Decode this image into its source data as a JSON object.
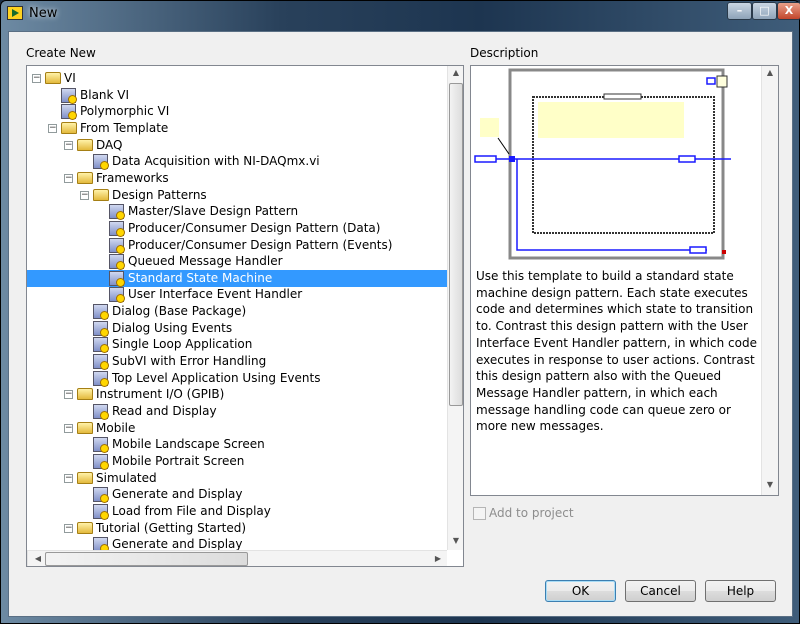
{
  "window": {
    "title": "New",
    "minimize": "–",
    "maximize": "□",
    "close": "X"
  },
  "create_new_label": "Create New",
  "description_label": "Description",
  "tree": [
    {
      "label": "VI",
      "level": 0,
      "type": "folder"
    },
    {
      "label": "Blank VI",
      "level": 1,
      "type": "vi"
    },
    {
      "label": "Polymorphic VI",
      "level": 1,
      "type": "vi"
    },
    {
      "label": "From Template",
      "level": 1,
      "type": "folder"
    },
    {
      "label": "DAQ",
      "level": 2,
      "type": "folder"
    },
    {
      "label": "Data Acquisition with NI-DAQmx.vi",
      "level": 3,
      "type": "vi"
    },
    {
      "label": "Frameworks",
      "level": 2,
      "type": "folder"
    },
    {
      "label": "Design Patterns",
      "level": 3,
      "type": "folder"
    },
    {
      "label": "Master/Slave Design Pattern",
      "level": 4,
      "type": "vi"
    },
    {
      "label": "Producer/Consumer Design Pattern (Data)",
      "level": 4,
      "type": "vi"
    },
    {
      "label": "Producer/Consumer Design Pattern (Events)",
      "level": 4,
      "type": "vi"
    },
    {
      "label": "Queued Message Handler",
      "level": 4,
      "type": "vi"
    },
    {
      "label": "Standard State Machine",
      "level": 4,
      "type": "vi",
      "selected": true
    },
    {
      "label": "User Interface Event Handler",
      "level": 4,
      "type": "vi"
    },
    {
      "label": "Dialog (Base Package)",
      "level": 3,
      "type": "vi"
    },
    {
      "label": "Dialog Using Events",
      "level": 3,
      "type": "vi"
    },
    {
      "label": "Single Loop Application",
      "level": 3,
      "type": "vi"
    },
    {
      "label": "SubVI with Error Handling",
      "level": 3,
      "type": "vi"
    },
    {
      "label": "Top Level Application Using Events",
      "level": 3,
      "type": "vi"
    },
    {
      "label": "Instrument I/O (GPIB)",
      "level": 2,
      "type": "folder"
    },
    {
      "label": "Read and Display",
      "level": 3,
      "type": "vi"
    },
    {
      "label": "Mobile",
      "level": 2,
      "type": "folder"
    },
    {
      "label": "Mobile Landscape Screen",
      "level": 3,
      "type": "vi"
    },
    {
      "label": "Mobile Portrait Screen",
      "level": 3,
      "type": "vi"
    },
    {
      "label": "Simulated",
      "level": 2,
      "type": "folder"
    },
    {
      "label": "Generate and Display",
      "level": 3,
      "type": "vi"
    },
    {
      "label": "Load from File and Display",
      "level": 3,
      "type": "vi"
    },
    {
      "label": "Tutorial (Getting Started)",
      "level": 2,
      "type": "folder"
    },
    {
      "label": "Generate and Display",
      "level": 3,
      "type": "vi"
    }
  ],
  "description_text": "Use this template to build a standard state machine design pattern. Each state executes code and determines which state to transition to. Contrast this design pattern with the User Interface Event Handler pattern, in which code executes in response to user actions. Contrast this design pattern also with the Queued Message Handler pattern, in which each message handling code can queue zero or more new messages.",
  "add_to_project_label": "Add to project",
  "buttons": {
    "ok": "OK",
    "cancel": "Cancel",
    "help": "Help"
  },
  "colors": {
    "selection": "#3399ff",
    "wire": "#1a1aff"
  }
}
